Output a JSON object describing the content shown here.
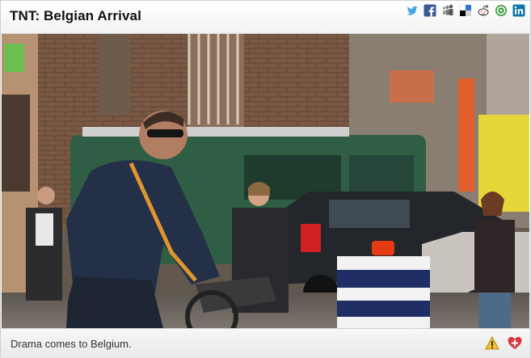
{
  "header": {
    "title": "TNT: Belgian Arrival",
    "share_icons": [
      "twitter-icon",
      "facebook-icon",
      "myspace-icon",
      "delicious-icon",
      "reddit-icon",
      "stumbleupon-icon",
      "linkedin-icon"
    ]
  },
  "video": {
    "scene": "video-frame"
  },
  "footer": {
    "caption": "Drama comes to Belgium.",
    "icons": [
      "warning-icon",
      "favorite-add-icon"
    ]
  },
  "colors": {
    "twitter": "#4aa8e0",
    "facebook": "#3b5998",
    "linkedin": "#0e76a8",
    "warning": "#f2c12e",
    "favorite": "#d9363e"
  }
}
